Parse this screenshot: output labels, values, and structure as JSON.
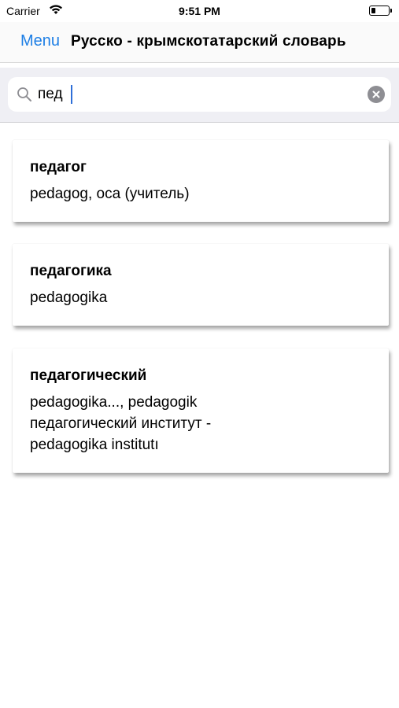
{
  "status_bar": {
    "carrier": "Carrier",
    "time": "9:51 PM"
  },
  "nav": {
    "menu_label": "Menu",
    "title": "Русско - крымскотатарский словарь",
    "accent_color": "#1e7fe5"
  },
  "search": {
    "value": "пед",
    "icon": "search-icon",
    "clear_icon": "clear-icon"
  },
  "results": [
    {
      "word": "педагог",
      "translation": "pedagog, oca (учитель)"
    },
    {
      "word": "педагогика",
      "translation": "pedagogika"
    },
    {
      "word": "педагогический",
      "translation": "pedagogika..., pedagogik\nпедагогический институт -\npedagogika institutı"
    }
  ]
}
